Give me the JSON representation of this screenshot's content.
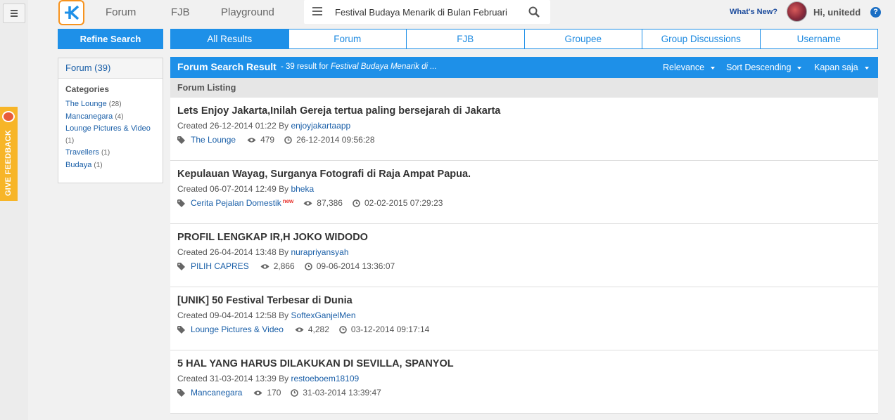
{
  "nav": {
    "links": [
      "Forum",
      "FJB",
      "Playground"
    ],
    "search_value": "Festival Budaya Menarik di Bulan Februari",
    "whats_new": "What's New?",
    "greeting": "Hi, unitedd",
    "help": "?"
  },
  "feedback": "GIVE FEEDBACK",
  "sidebar": {
    "refine": "Refine Search",
    "forum_filter": "Forum (39)",
    "categories_heading": "Categories",
    "categories": [
      {
        "name": "The Lounge",
        "count": "(28)"
      },
      {
        "name": "Mancanegara",
        "count": "(4)"
      },
      {
        "name": "Lounge Pictures & Video",
        "count": "(1)"
      },
      {
        "name": "Travellers",
        "count": "(1)"
      },
      {
        "name": "Budaya",
        "count": "(1)"
      }
    ]
  },
  "tabs": [
    "All Results",
    "Forum",
    "FJB",
    "Groupee",
    "Group Discussions",
    "Username"
  ],
  "result_header": {
    "title": "Forum Search Result",
    "meta_prefix": "- 39 result for",
    "meta_query": "Festival Budaya Menarik di ...",
    "sort_relevance": "Relevance",
    "sort_order": "Sort Descending",
    "sort_time": "Kapan saja"
  },
  "listing_heading": "Forum Listing",
  "results": [
    {
      "title": "Lets Enjoy Jakarta,Inilah Gereja tertua paling bersejarah di Jakarta",
      "created": "Created 26-12-2014 01:22 By",
      "author": "enjoyjakartaapp",
      "category": "The Lounge",
      "new": "",
      "views": "479",
      "last_post": "26-12-2014 09:56:28"
    },
    {
      "title": "Kepulauan Wayag, Surganya Fotografi di Raja Ampat Papua.",
      "created": "Created 06-07-2014 12:49 By",
      "author": "bheka",
      "category": "Cerita Pejalan Domestik",
      "new": "new",
      "views": "87,386",
      "last_post": "02-02-2015 07:29:23"
    },
    {
      "title": "PROFIL LENGKAP IR,H JOKO WIDODO",
      "created": "Created 26-04-2014 13:48 By",
      "author": "nurapriyansyah",
      "category": "PILIH CAPRES",
      "new": "",
      "views": "2,866",
      "last_post": "09-06-2014 13:36:07"
    },
    {
      "title": "[UNIK] 50 Festival Terbesar di Dunia",
      "created": "Created 09-04-2014 12:58 By",
      "author": "SoftexGanjelMen",
      "category": "Lounge Pictures & Video",
      "new": "",
      "views": "4,282",
      "last_post": "03-12-2014 09:17:14"
    },
    {
      "title": "5 HAL YANG HARUS DILAKUKAN DI SEVILLA, SPANYOL",
      "created": "Created 31-03-2014 13:39 By",
      "author": "restoeboem18109",
      "category": "Mancanegara",
      "new": "",
      "views": "170",
      "last_post": "31-03-2014 13:39:47"
    }
  ]
}
